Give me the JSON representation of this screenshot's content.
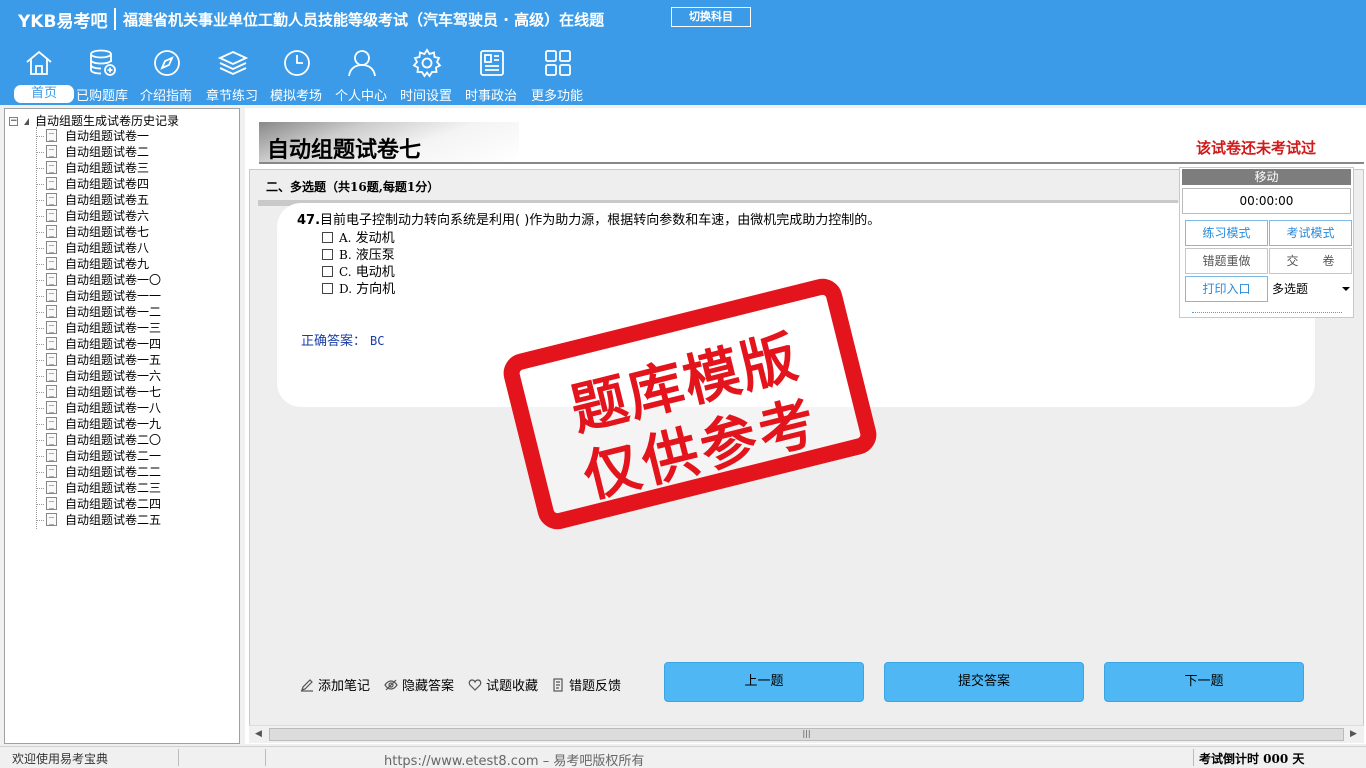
{
  "header": {
    "brand": "YKB易考吧",
    "title": "福建省机关事业单位工勤人员技能等级考试（汽车驾驶员 · 高级）在线题",
    "switch_label": "切换科目"
  },
  "nav": [
    {
      "label": "首页",
      "icon": "home-icon",
      "active": true
    },
    {
      "label": "已购题库",
      "icon": "database-icon"
    },
    {
      "label": "介绍指南",
      "icon": "compass-icon"
    },
    {
      "label": "章节练习",
      "icon": "layers-icon"
    },
    {
      "label": "模拟考场",
      "icon": "clock-icon"
    },
    {
      "label": "个人中心",
      "icon": "user-icon"
    },
    {
      "label": "时间设置",
      "icon": "gear-icon"
    },
    {
      "label": "时事政治",
      "icon": "news-icon"
    },
    {
      "label": "更多功能",
      "icon": "grid-icon"
    }
  ],
  "tree": {
    "root": "自动组题生成试卷历史记录",
    "items": [
      "自动组题试卷一",
      "自动组题试卷二",
      "自动组题试卷三",
      "自动组题试卷四",
      "自动组题试卷五",
      "自动组题试卷六",
      "自动组题试卷七",
      "自动组题试卷八",
      "自动组题试卷九",
      "自动组题试卷一〇",
      "自动组题试卷一一",
      "自动组题试卷一二",
      "自动组题试卷一三",
      "自动组题试卷一四",
      "自动组题试卷一五",
      "自动组题试卷一六",
      "自动组题试卷一七",
      "自动组题试卷一八",
      "自动组题试卷一九",
      "自动组题试卷二〇",
      "自动组题试卷二一",
      "自动组题试卷二二",
      "自动组题试卷二三",
      "自动组题试卷二四",
      "自动组题试卷二五"
    ],
    "selected_index": 6
  },
  "paper": {
    "title": "自动组题试卷七",
    "status": "该试卷还未考试过",
    "section": "二、多选题（共16题,每题1分）"
  },
  "question": {
    "number": "47.",
    "text": "目前电子控制动力转向系统是利用( )作为助力源，根据转向参数和车速，由微机完成助力控制的。",
    "options": [
      {
        "letter": "A.",
        "text": "发动机"
      },
      {
        "letter": "B.",
        "text": "液压泵"
      },
      {
        "letter": "C.",
        "text": "电动机"
      },
      {
        "letter": "D.",
        "text": "方向机"
      }
    ],
    "answer_label": "正确答案：",
    "answer_value": "BC"
  },
  "tools": {
    "note": "添加笔记",
    "hide_answer": "隐藏答案",
    "favorite": "试题收藏",
    "feedback": "错题反馈"
  },
  "buttons": {
    "prev": "上一题",
    "submit": "提交答案",
    "next": "下一题"
  },
  "timer": {
    "header": "移动",
    "clock": "00:00:00",
    "practice_mode": "练习模式",
    "exam_mode": "考试模式",
    "redo_wrong": "错题重做",
    "hand_in": "交　　卷",
    "print": "打印入口",
    "type_select": "多选题"
  },
  "stamp": {
    "line1": "题库模版",
    "line2": "仅供参考"
  },
  "status": {
    "welcome": "欢迎使用易考宝典",
    "copyright": "https://www.etest8.com – 易考吧版权所有",
    "countdown": "考试倒计时 000 天"
  },
  "colors": {
    "header_bg": "#3c9be8",
    "button_blue": "#4fb8f4",
    "status_red": "#d11a1a",
    "stamp_red": "#e3141c",
    "answer_blue": "#1a3ea8"
  }
}
